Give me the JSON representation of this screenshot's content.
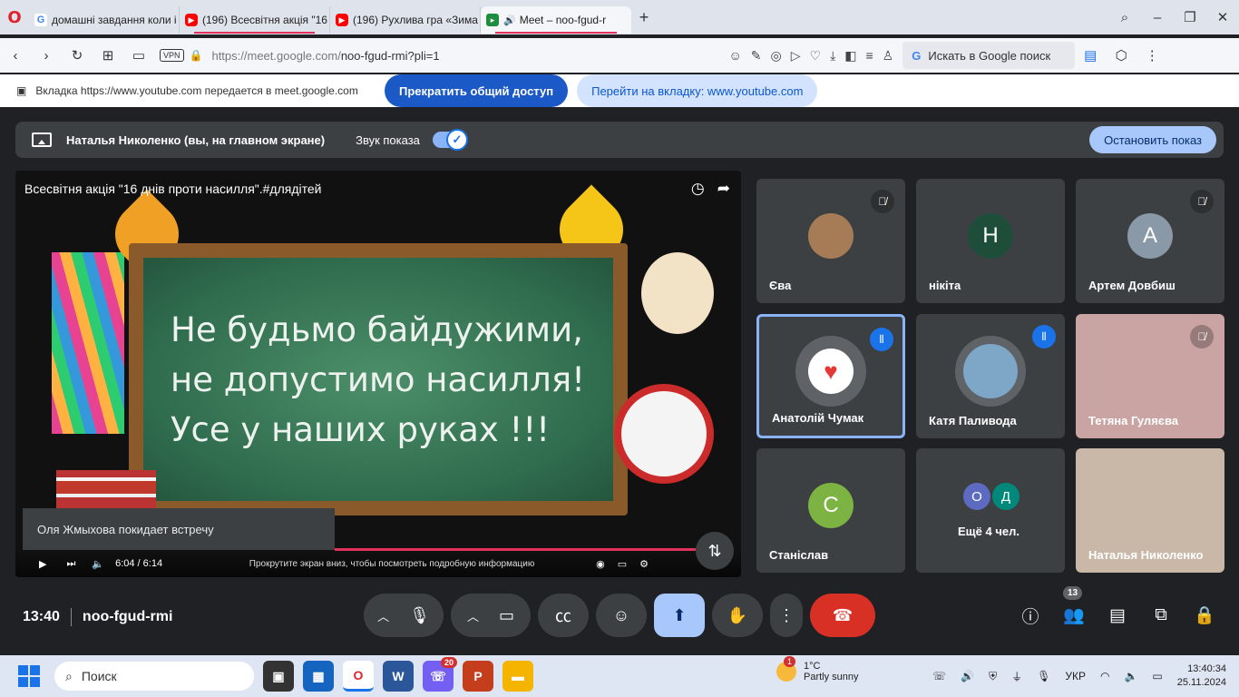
{
  "browser": {
    "tabs": [
      {
        "label": "домашні завдання коли і",
        "icon": "google-icon"
      },
      {
        "label": "(196) Всесвітня акція \"16",
        "icon": "youtube-icon"
      },
      {
        "label": "(196) Рухлива гра «Зима",
        "icon": "youtube-icon"
      },
      {
        "label": "Meet – noo-fgud-r",
        "icon": "meet-icon"
      }
    ],
    "url_host": "https://meet.google.com/",
    "url_path": "noo-fgud-rmi?pli=1",
    "vpn": "VPN",
    "search_placeholder": "Искать в Google поиск"
  },
  "share_bar": {
    "text": "Вкладка https://www.youtube.com передается в meet.google.com",
    "stop_label": "Прекратить общий доступ",
    "goto_label": "Перейти на вкладку: www.youtube.com"
  },
  "presenting": {
    "name": "Наталья Николенко (вы, на главном экране)",
    "sound_label": "Звук показа",
    "stop_label": "Остановить показ"
  },
  "video": {
    "title": "Всесвітня акція \"16 днів проти насилля\".#длядітей",
    "lines": [
      "Не будьмо байдужими,",
      "не допустимо насилля!",
      "Усе у наших руках !!!"
    ],
    "time": "6:04 / 6:14",
    "hint": "Прокрутите экран вниз, чтобы посмотреть подробную информацию",
    "progress": 0.97,
    "toast": "Оля Жмыхова покидает встречу"
  },
  "participants": [
    {
      "name": "Єва",
      "avatar": "",
      "color": "#a57c55",
      "state": "muted"
    },
    {
      "name": "нікіта",
      "avatar": "Н",
      "color": "#1e4d3a",
      "state": "none"
    },
    {
      "name": "Артем Довбиш",
      "avatar": "А",
      "color": "#8a99a8",
      "state": "muted"
    },
    {
      "name": "Анатолій Чумак",
      "avatar": "",
      "color": "#ffffff",
      "state": "speaking"
    },
    {
      "name": "Катя Паливода",
      "avatar": "",
      "color": "#7da6c7",
      "state": "speaking"
    },
    {
      "name": "Тетяна Гуляєва",
      "avatar": "",
      "color": "#caa3a3",
      "state": "muted"
    },
    {
      "name": "Станіслав",
      "avatar": "С",
      "color": "#7cb342",
      "state": "none"
    },
    {
      "name": "Ещё 4 чел.",
      "avatar_a": "О",
      "avatar_b": "Д",
      "state": "none"
    },
    {
      "name": "Наталья Николенко",
      "avatar": "",
      "color": "#c9b8a8",
      "state": "none"
    }
  ],
  "meeting": {
    "time": "13:40",
    "code": "noo-fgud-rmi",
    "people_count": "13"
  },
  "taskbar": {
    "search": "Поиск",
    "viber_badge": "20",
    "weather_badge": "1",
    "temp": "1°C",
    "condition": "Partly sunny",
    "lang": "УКР",
    "time": "13:40:34",
    "date": "25.11.2024"
  }
}
